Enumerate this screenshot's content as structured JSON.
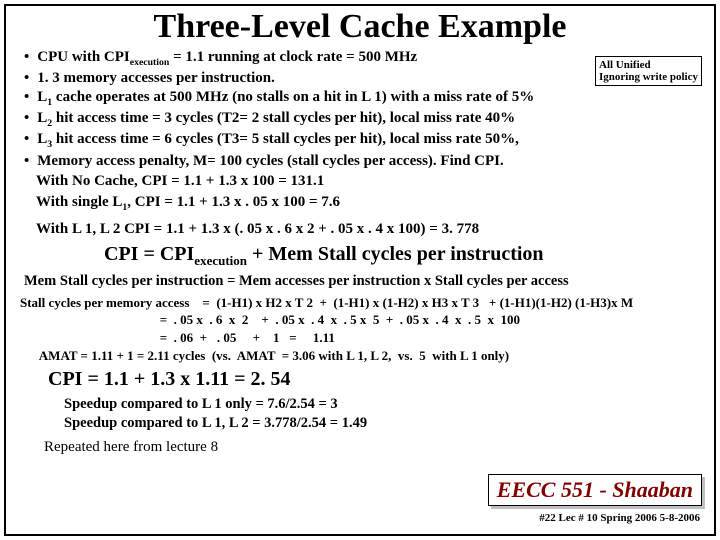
{
  "title": "Three-Level Cache Example",
  "note": {
    "l1": "All Unified",
    "l2": "Ignoring write policy"
  },
  "bullets": [
    "CPU with CPI<sub>execution</sub> = 1.1  running at clock rate = 500 MHz",
    "1. 3 memory accesses per instruction.",
    "L<sub>1</sub> cache operates at 500 MHz (no stalls on a hit in L 1) with a miss rate of 5%",
    "L<sub>2</sub> hit access time = 3 cycles (T2= 2 stall cycles per hit),  local miss rate  40%",
    "L<sub>3</sub> hit access time = 6 cycles (T3= 5 stall cycles per hit), local miss rate 50%,",
    "Memory access penalty,  M= 100 cycles  (stall cycles per access).    Find CPI."
  ],
  "calc": {
    "nocache": "With No Cache,        CPI  =  1.1 +  1.3 x 100  =  131.1",
    "l1only": "With single L<sub>1</sub>,      CPI  =  1.1  +  1.3 x . 05 x 100 =  7.6",
    "l1l2": "With L 1,  L 2           CPI  =  1.1  +  1.3 x  (. 05 x  . 6 x  2  +  . 05 x  . 4  x  100)  = 3. 778"
  },
  "cpi_main": "CPI  =    CPI<sub>execution</sub>  +    Mem Stall  cycles per instruction",
  "mem_line": "Mem Stall cycles per instruction =  Mem accesses per instruction  x  Stall cycles per access",
  "stall": {
    "l1": "Stall cycles per memory access    =  (1-H1) x H2 x T 2  +  (1-H1) x (1-H2) x H3 x T 3   + (1-H1)(1-H2) (1-H3)x M",
    "l2": "                                           =  . 05 x  . 6  x  2    +  . 05 x  . 4  x  . 5 x  5  +  . 05 x  . 4  x  . 5  x  100",
    "l3": "                                           =  . 06  +   . 05     +    1   =     1.11",
    "amat": "      AMAT = 1.11 + 1 = 2.11 cycles  (vs.  AMAT  = 3.06 with L 1, L 2,  vs.  5  with L 1 only)"
  },
  "cpi_final": "CPI = 1.1 +  1.3 x 1.11   =   2. 54",
  "speedup": {
    "s1": "Speedup compared to L 1 only =   7.6/2.54   =   3",
    "s2": "Speedup compared to L 1, L 2   =  3.778/2.54  =  1.49"
  },
  "repeat": "Repeated here from lecture 8",
  "badge": "EECC 551 - Shaaban",
  "footer_sub": "#22  Lec # 10  Spring 2006  5-8-2006"
}
